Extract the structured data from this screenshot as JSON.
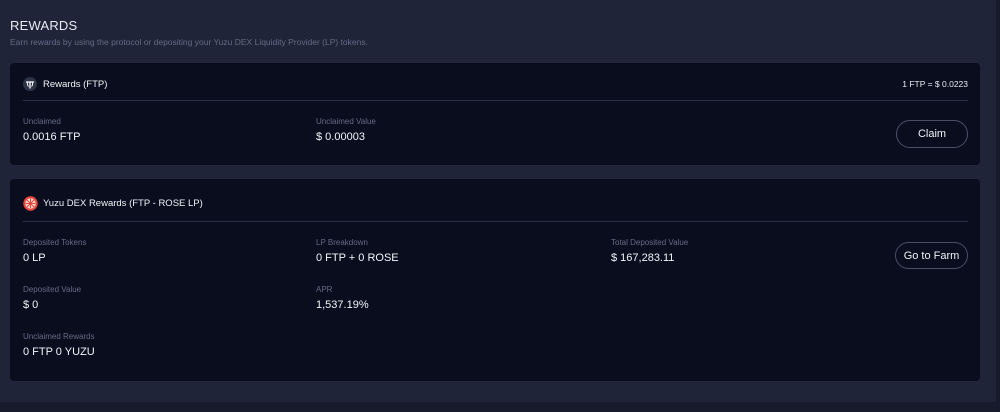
{
  "header": {
    "title": "REWARDS",
    "subtitle": "Earn rewards by using the protocol or depositing your Yuzu DEX Liquidity Provider (LP) tokens."
  },
  "ftp_card": {
    "icon": "ftp-token-icon",
    "title": "Rewards (FTP)",
    "rate": "1 FTP  =  $ 0.0223",
    "unclaimed_label": "Unclaimed",
    "unclaimed_value": "0.0016 FTP",
    "unclaimed_value_label": "Unclaimed Value",
    "unclaimed_value_amount": "$ 0.00003",
    "claim_label": "Claim"
  },
  "yuzu_card": {
    "icon": "yuzu-fruit-icon",
    "title": "Yuzu DEX Rewards (FTP - ROSE LP)",
    "deposited_tokens_label": "Deposited Tokens",
    "deposited_tokens_value": "0 LP",
    "lp_breakdown_label": "LP Breakdown",
    "lp_breakdown_value": "0 FTP + 0 ROSE",
    "total_deposited_label": "Total Deposited Value",
    "total_deposited_value": "$ 167,283.11",
    "deposited_value_label": "Deposited Value",
    "deposited_value_value": "$ 0",
    "apr_label": "APR",
    "apr_value": "1,537.19%",
    "unclaimed_rewards_label": "Unclaimed Rewards",
    "unclaimed_rewards_value": "0 FTP 0 YUZU",
    "farm_label": "Go to Farm"
  },
  "colors": {
    "background": "#1f2438",
    "card": "#0a0d1e",
    "muted_text": "#646b86",
    "accent_yuzu": "#e8473f"
  }
}
